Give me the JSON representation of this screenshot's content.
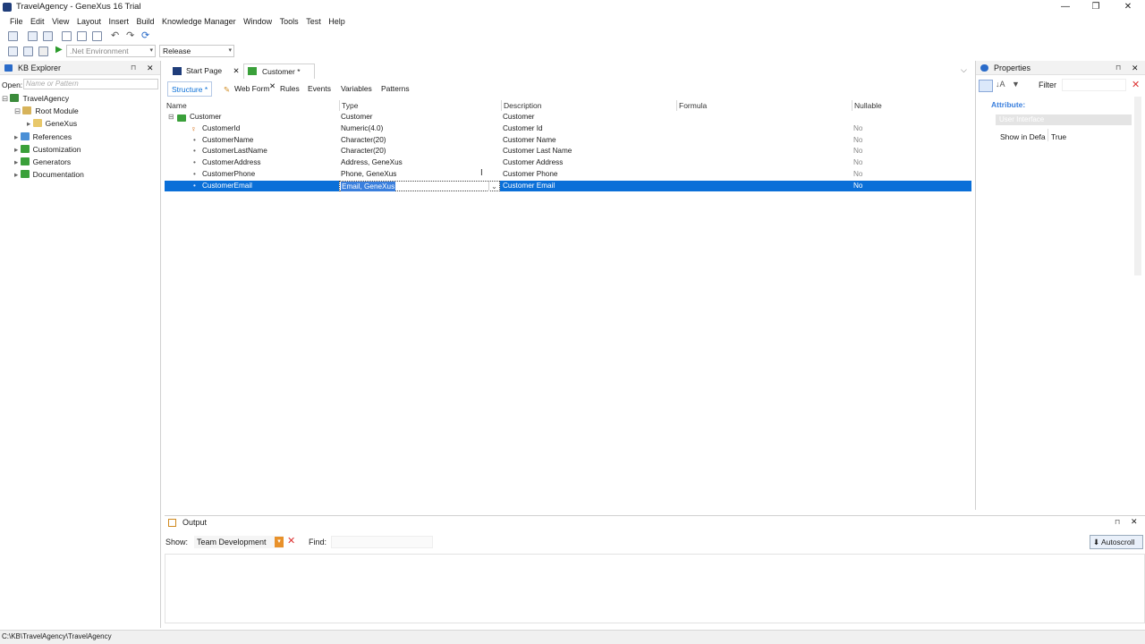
{
  "window": {
    "title": "TravelAgency - GeneXus 16 Trial"
  },
  "menu": [
    "File",
    "Edit",
    "View",
    "Layout",
    "Insert",
    "Build",
    "Knowledge Manager",
    "Window",
    "Tools",
    "Test",
    "Help"
  ],
  "toolbar": {
    "environment": ".Net Environment",
    "configuration": "Release"
  },
  "kb_explorer": {
    "title": "KB Explorer",
    "open_label": "Open:",
    "open_placeholder": "Name or Pattern",
    "tree": [
      {
        "label": "TravelAgency",
        "level": 0,
        "icon": "kb-icon"
      },
      {
        "label": "Root Module",
        "level": 1,
        "icon": "module-icon"
      },
      {
        "label": "GeneXus",
        "level": 2,
        "icon": "folder-icon"
      },
      {
        "label": "References",
        "level": 1,
        "icon": "references-icon"
      },
      {
        "label": "Customization",
        "level": 1,
        "icon": "customization-icon"
      },
      {
        "label": "Generators",
        "level": 1,
        "icon": "generators-icon"
      },
      {
        "label": "Documentation",
        "level": 1,
        "icon": "documentation-icon"
      }
    ]
  },
  "tabs": [
    {
      "label": "Start Page",
      "active": false
    },
    {
      "label": "Customer *",
      "active": true
    }
  ],
  "subtabs": [
    "Structure *",
    "Web Form",
    "Rules",
    "Events",
    "Variables",
    "Patterns"
  ],
  "structure": {
    "columns": [
      "Name",
      "Type",
      "Description",
      "Formula",
      "Nullable"
    ],
    "rows": [
      {
        "name": "Customer",
        "type": "Customer",
        "description": "Customer",
        "formula": "",
        "nullable": "",
        "kind": "root"
      },
      {
        "name": "CustomerId",
        "type": "Numeric(4.0)",
        "description": "Customer Id",
        "formula": "",
        "nullable": "No",
        "kind": "key"
      },
      {
        "name": "CustomerName",
        "type": "Character(20)",
        "description": "Customer Name",
        "formula": "",
        "nullable": "No",
        "kind": "attr"
      },
      {
        "name": "CustomerLastName",
        "type": "Character(20)",
        "description": "Customer Last Name",
        "formula": "",
        "nullable": "No",
        "kind": "attr"
      },
      {
        "name": "CustomerAddress",
        "type": "Address, GeneXus",
        "description": "Customer Address",
        "formula": "",
        "nullable": "No",
        "kind": "attr"
      },
      {
        "name": "CustomerPhone",
        "type": "Phone, GeneXus",
        "description": "Customer Phone",
        "formula": "",
        "nullable": "No",
        "kind": "attr"
      },
      {
        "name": "CustomerEmail",
        "type": "Email, GeneXus",
        "description": "Customer Email",
        "formula": "",
        "nullable": "No",
        "kind": "attr",
        "selected": true
      }
    ]
  },
  "properties": {
    "title": "Properties",
    "filter_label": "Filter",
    "category": "Attribute:",
    "group": "User Interface",
    "prop_name": "Show in Defa",
    "prop_value": "True"
  },
  "output": {
    "title": "Output",
    "show_label": "Show:",
    "show_value": "Team Development",
    "find_label": "Find:",
    "autoscroll_label": "Autoscroll"
  },
  "status": {
    "path": "C:\\KB\\TravelAgency\\TravelAgency"
  }
}
